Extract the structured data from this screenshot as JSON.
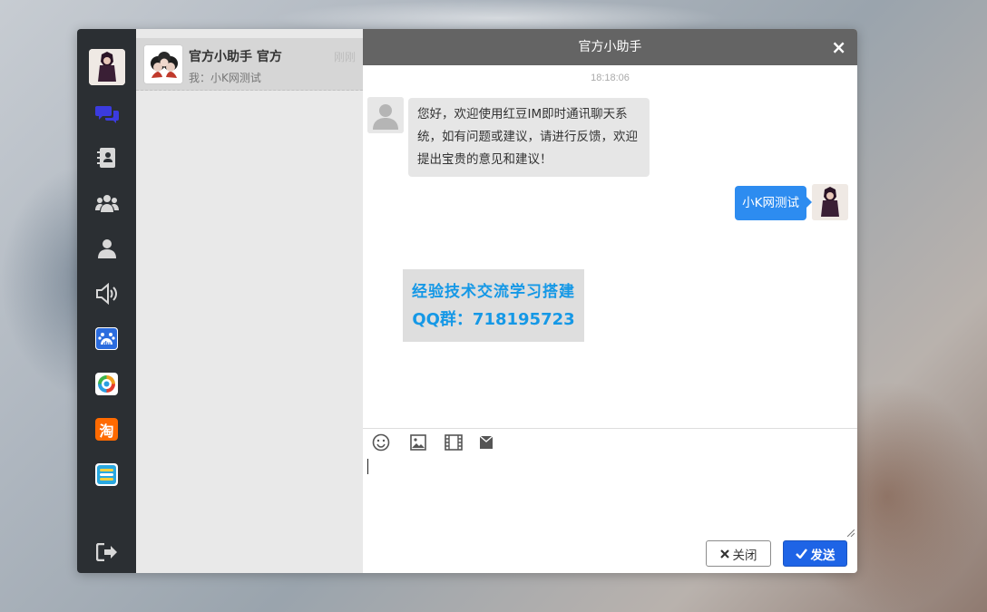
{
  "sidebar": {
    "items": [
      {
        "name": "chat",
        "icon": "chat-bubbles-icon",
        "color": "#3b3bdf"
      },
      {
        "name": "contacts",
        "icon": "address-book-icon",
        "color": "#d8d8d8"
      },
      {
        "name": "groups",
        "icon": "group-icon",
        "color": "#d8d8d8"
      },
      {
        "name": "profile",
        "icon": "user-icon",
        "color": "#d8d8d8"
      },
      {
        "name": "sound",
        "icon": "speaker-icon",
        "color": "#d8d8d8"
      },
      {
        "name": "baidu",
        "icon": "baidu-app-icon",
        "label": "du"
      },
      {
        "name": "tencent-news",
        "icon": "tencent-news-app-icon"
      },
      {
        "name": "taobao",
        "icon": "taobao-app-icon",
        "label": "淘"
      },
      {
        "name": "stack-app",
        "icon": "stack-app-icon"
      }
    ],
    "logout_icon": "logout-icon"
  },
  "conversations": [
    {
      "name": "官方小助手 官方",
      "time": "刚刚",
      "preview": "我：小K网测试"
    }
  ],
  "chat": {
    "title": "官方小助手",
    "close_glyph": "×",
    "timestamp": "18:18:06",
    "messages": [
      {
        "side": "left",
        "text": "您好，欢迎使用红豆IM即时通讯聊天系统，如有问题或建议，请进行反馈，欢迎提出宝贵的意见和建议！"
      },
      {
        "side": "right",
        "text": "小K网测试"
      }
    ],
    "watermark": {
      "line1": "经验技术交流学习搭建",
      "line2": "QQ群：718195723"
    },
    "tools": [
      "emoji-icon",
      "image-icon",
      "video-icon",
      "file-icon"
    ],
    "input_value": "",
    "close_button": "关闭",
    "send_button": "发送"
  },
  "colors": {
    "navbar": "#2b2f33",
    "header": "#646464",
    "accent": "#2d8cf0",
    "send": "#1e64e6"
  }
}
